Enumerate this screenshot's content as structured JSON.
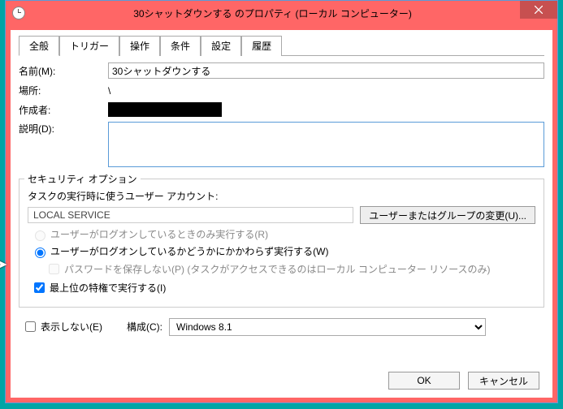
{
  "window": {
    "title": "30シャットダウンする のプロパティ (ローカル コンピューター)"
  },
  "tabs": [
    {
      "label": "全般",
      "active": true
    },
    {
      "label": "トリガー",
      "active": false
    },
    {
      "label": "操作",
      "active": false
    },
    {
      "label": "条件",
      "active": false
    },
    {
      "label": "設定",
      "active": false
    },
    {
      "label": "履歴",
      "active": false
    }
  ],
  "general": {
    "name_label": "名前(M):",
    "name_value": "30シャットダウンする",
    "location_label": "場所:",
    "location_value": "\\",
    "author_label": "作成者:",
    "description_label": "説明(D):",
    "description_value": ""
  },
  "security": {
    "legend": "セキュリティ オプション",
    "account_label": "タスクの実行時に使うユーザー アカウント:",
    "account_value": "LOCAL SERVICE",
    "change_user_btn": "ユーザーまたはグループの変更(U)...",
    "radio_logged_on": "ユーザーがログオンしているときのみ実行する(R)",
    "radio_any": "ユーザーがログオンしているかどうかにかかわらず実行する(W)",
    "check_nopass": "パスワードを保存しない(P) (タスクがアクセスできるのはローカル コンピューター リソースのみ)",
    "check_highest": "最上位の特権で実行する(I)"
  },
  "bottom": {
    "check_hidden": "表示しない(E)",
    "configure_label": "構成(C):",
    "configure_value": "Windows 8.1"
  },
  "footer": {
    "ok": "OK",
    "cancel": "キャンセル"
  }
}
